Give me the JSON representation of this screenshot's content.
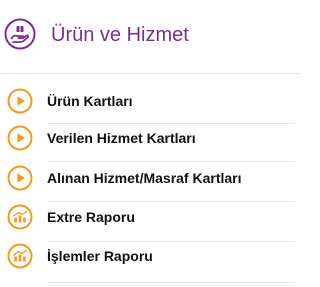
{
  "menu": {
    "title": "Ürün ve Hizmet",
    "title_icon": "hand-holding-box-icon",
    "accent_color": "#7a2e92",
    "item_icon_color": "#f39a1e",
    "items": [
      {
        "label": "Ürün Kartları",
        "icon": "play-circle-icon"
      },
      {
        "label": "Verilen Hizmet Kartları",
        "icon": "play-circle-icon"
      },
      {
        "label": "Alınan Hizmet/Masraf Kartları",
        "icon": "play-circle-icon"
      },
      {
        "label": "Extre Raporu",
        "icon": "bar-chart-circle-icon"
      },
      {
        "label": "İşlemler Raporu",
        "icon": "bar-chart-circle-icon"
      }
    ]
  }
}
